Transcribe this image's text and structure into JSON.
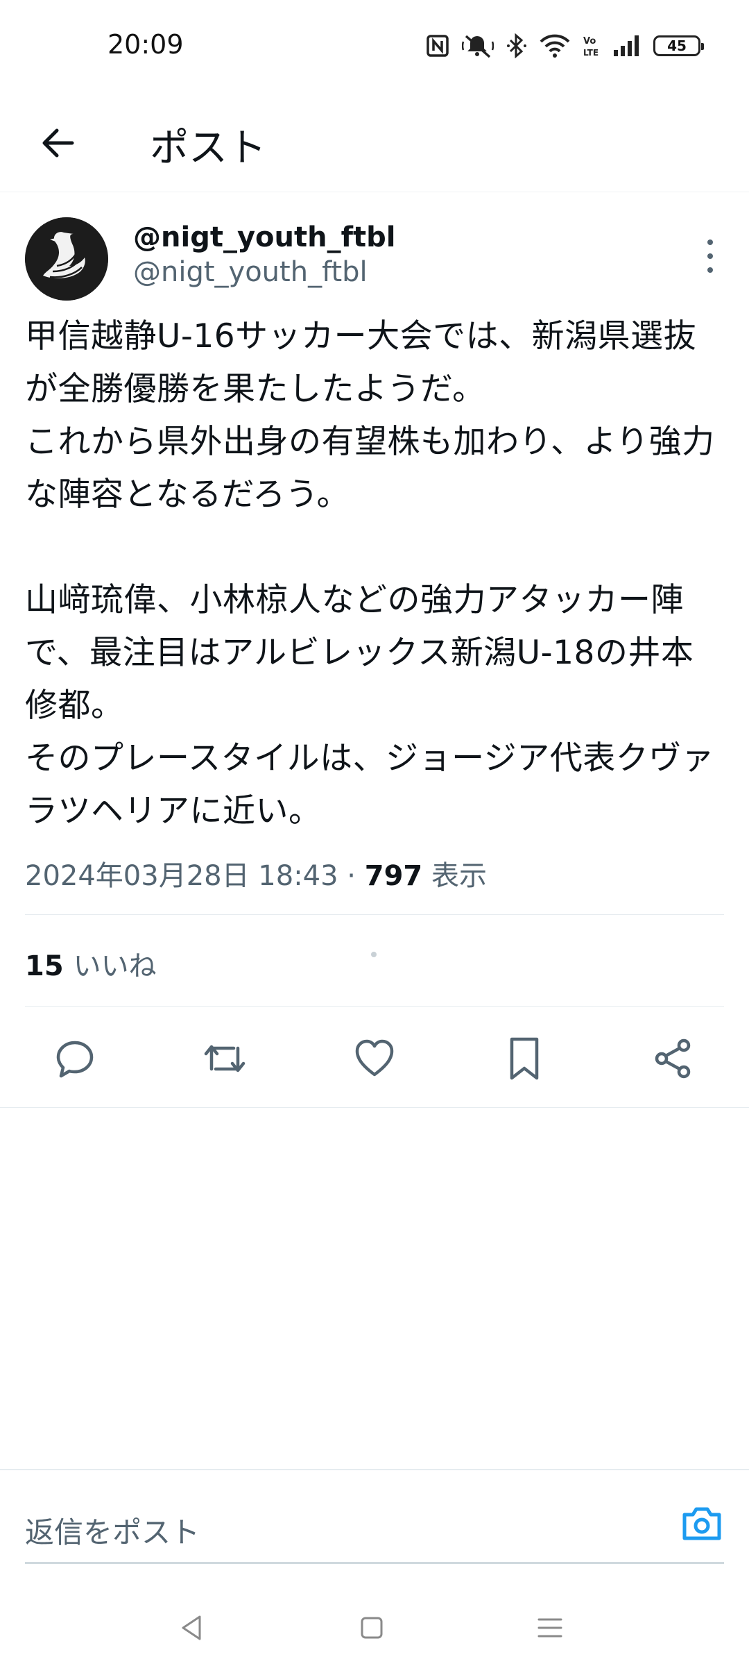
{
  "status_bar": {
    "time": "20:09",
    "battery_level": "45",
    "icons": [
      "nfc-icon",
      "mute-icon",
      "bluetooth-icon",
      "wifi-icon",
      "volte-icon",
      "signal-icon",
      "battery-icon"
    ]
  },
  "header": {
    "title": "ポスト",
    "back_icon": "arrow-left-icon"
  },
  "post": {
    "display_name": "@nigt_youth_ftbl",
    "handle": "@nigt_youth_ftbl",
    "body": "甲信越静U-16サッカー大会では、新潟県選抜が全勝優勝を果たしたようだ。\nこれから県外出身の有望株も加わり、より強力な陣容となるだろう。\n\n山﨑琉偉、小林椋人などの強力アタッカー陣で、最注目はアルビレックス新潟U-18の井本修都。\nそのプレースタイルは、ジョージア代表クヴァラツヘリアに近い。",
    "timestamp": "2024年03月28日 18:43",
    "separator": " · ",
    "views_count": "797",
    "views_label": " 表示",
    "likes_count": "15",
    "likes_label": "いいね"
  },
  "actions": [
    "reply-icon",
    "repost-icon",
    "like-icon",
    "bookmark-icon",
    "share-icon"
  ],
  "reply": {
    "placeholder": "返信をポスト"
  },
  "colors": {
    "accent": "#1d9bf0",
    "text_primary": "#0f1419",
    "text_secondary": "#536471",
    "divider": "#e6ecf0"
  }
}
